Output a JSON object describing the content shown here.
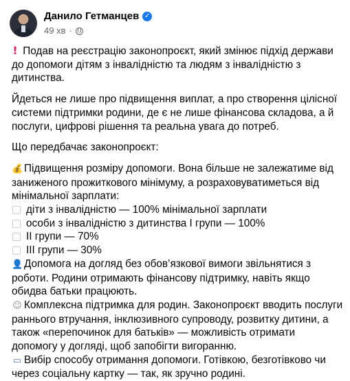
{
  "author": {
    "name": "Данило Гетманцев",
    "time": "49 хв",
    "visibility_icon": "globe-icon",
    "verified_icon": "verified-badge-icon"
  },
  "post": {
    "p1": "Подав на реєстрацію законопроєкт, який змінює підхід держави до допомоги дітям з інвалідністю та людям з інвалідністю з дитинства.",
    "p2": "Йдеться не лише про підвищення виплат, а про створення цілісної системи підтримки родини, де є не лише фінансова складова, а й послуги, цифрові рішення та реальна увага до потреб.",
    "p3": "Що передбачає законопроєкт:",
    "item1": "Підвищення розміру допомоги. Вона більше не залежатиме від заниженого прожиткового мінімуму, а розраховуватиметься від мінімальної зарплати:",
    "bullets": [
      "діти з інвалідністю — 100% мінімальної зарплати",
      "особи з інвалідністю з дитинства І групи — 100%",
      "ІІ групи — 70%",
      "ІІІ групи — 30%"
    ],
    "item2": "Допомога на догляд без обов’язкової вимоги звільнятися з роботи. Родини отримають фінансову підтримку, навіть якщо обидва батьки працюють.",
    "item3": "Комплексна підтримка для родин. Законопроєкт вводить послуги раннього втручання, інклюзивного супроводу, розвитку дитини, а також «перепочинок для батьків» — можливість отримати допомогу у догляді, щоб запобігти вигоранню.",
    "item4": "Вибір способу отримання допомоги. Готівкою, безготівково чи через соціальну картку — так, як зручно родині."
  },
  "icons": {
    "p1": "exclamation-icon",
    "item1": "money-bag-icon",
    "item2": "caregiver-icon",
    "item3": "baby-icon",
    "item4": "credit-card-icon"
  },
  "colors": {
    "link_blue": "#1877f2",
    "secondary_text": "#65676b",
    "text": "#050505"
  }
}
